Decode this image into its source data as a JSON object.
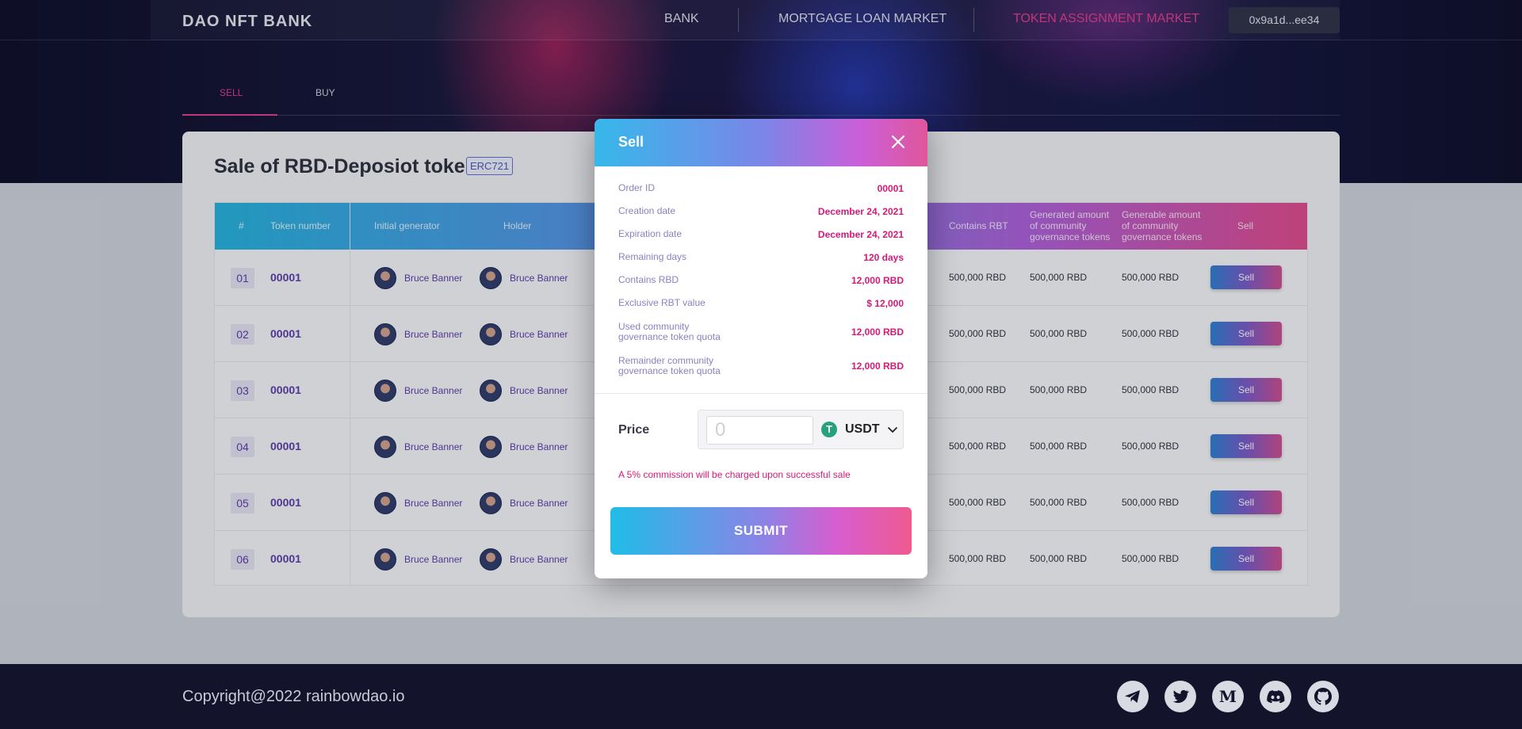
{
  "nav": {
    "brand": "DAO NFT BANK",
    "links": [
      "BANK",
      "MORTGAGE LOAN MARKET",
      "TOKEN ASSIGNMENT MARKET"
    ],
    "active_link": "TOKEN ASSIGNMENT MARKET",
    "wallet": "0x9a1d...ee34"
  },
  "tabs": [
    "SELL",
    "BUY"
  ],
  "card": {
    "title": "Sale of RBD-Deposiot tokens",
    "badge": "ERC721"
  },
  "table": {
    "headers": {
      "index": "#",
      "token_number": "Token number",
      "initial_generator": "Initial generator",
      "holder": "Holder",
      "contains_rbt": "Contains RBT",
      "generated": "Generated amount of community governance tokens",
      "generable": "Generable amount of community governance tokens",
      "sell": "Sell"
    },
    "rows": [
      {
        "index": "01",
        "token": "00001",
        "generator": "Bruce Banner",
        "holder": "Bruce Banner",
        "contains_rbt": "500,000 RBD",
        "generated": "500,000 RBD",
        "generable": "500,000 RBD",
        "action": "Sell"
      },
      {
        "index": "02",
        "token": "00001",
        "generator": "Bruce Banner",
        "holder": "Bruce Banner",
        "contains_rbt": "500,000 RBD",
        "generated": "500,000 RBD",
        "generable": "500,000 RBD",
        "action": "Sell"
      },
      {
        "index": "03",
        "token": "00001",
        "generator": "Bruce Banner",
        "holder": "Bruce Banner",
        "contains_rbt": "500,000 RBD",
        "generated": "500,000 RBD",
        "generable": "500,000 RBD",
        "action": "Sell"
      },
      {
        "index": "04",
        "token": "00001",
        "generator": "Bruce Banner",
        "holder": "Bruce Banner",
        "contains_rbt": "500,000 RBD",
        "generated": "500,000 RBD",
        "generable": "500,000 RBD",
        "action": "Sell"
      },
      {
        "index": "05",
        "token": "00001",
        "generator": "Bruce Banner",
        "holder": "Bruce Banner",
        "contains_rbt": "500,000 RBD",
        "generated": "500,000 RBD",
        "generable": "500,000 RBD",
        "action": "Sell"
      },
      {
        "index": "06",
        "token": "00001",
        "generator": "Bruce Banner",
        "holder": "Bruce Banner",
        "contains_rbt": "500,000 RBD",
        "generated": "500,000 RBD",
        "generable": "500,000 RBD",
        "action": "Sell"
      }
    ]
  },
  "modal": {
    "title": "Sell",
    "details": [
      {
        "label": "Order ID",
        "value": "00001"
      },
      {
        "label": "Creation date",
        "value": "December 24, 2021"
      },
      {
        "label": "Expiration date",
        "value": "December 24, 2021"
      },
      {
        "label": "Remaining days",
        "value": "120 days"
      },
      {
        "label": "Contains RBD",
        "value": "12,000 RBD"
      },
      {
        "label": "Exclusive RBT value",
        "value": "$ 12,000"
      },
      {
        "label": "Used community governance token quota",
        "value": "12,000 RBD"
      },
      {
        "label": "Remainder community governance token quota",
        "value": "12,000 RBD"
      }
    ],
    "price_label": "Price",
    "price_placeholder": "0",
    "currency": "USDT",
    "currency_icon_glyph": "T",
    "commission_note": "A 5% commission will be charged upon successful sale",
    "submit": "SUBMIT"
  },
  "footer": {
    "copyright": "Copyright@2022 rainbowdao.io",
    "socials": [
      "telegram-icon",
      "twitter-icon",
      "medium-icon",
      "discord-icon",
      "github-icon"
    ]
  },
  "colors": {
    "accent_pink": "#d6197a",
    "accent_purple": "#5b3aa8",
    "tether_green": "#26a17b"
  }
}
